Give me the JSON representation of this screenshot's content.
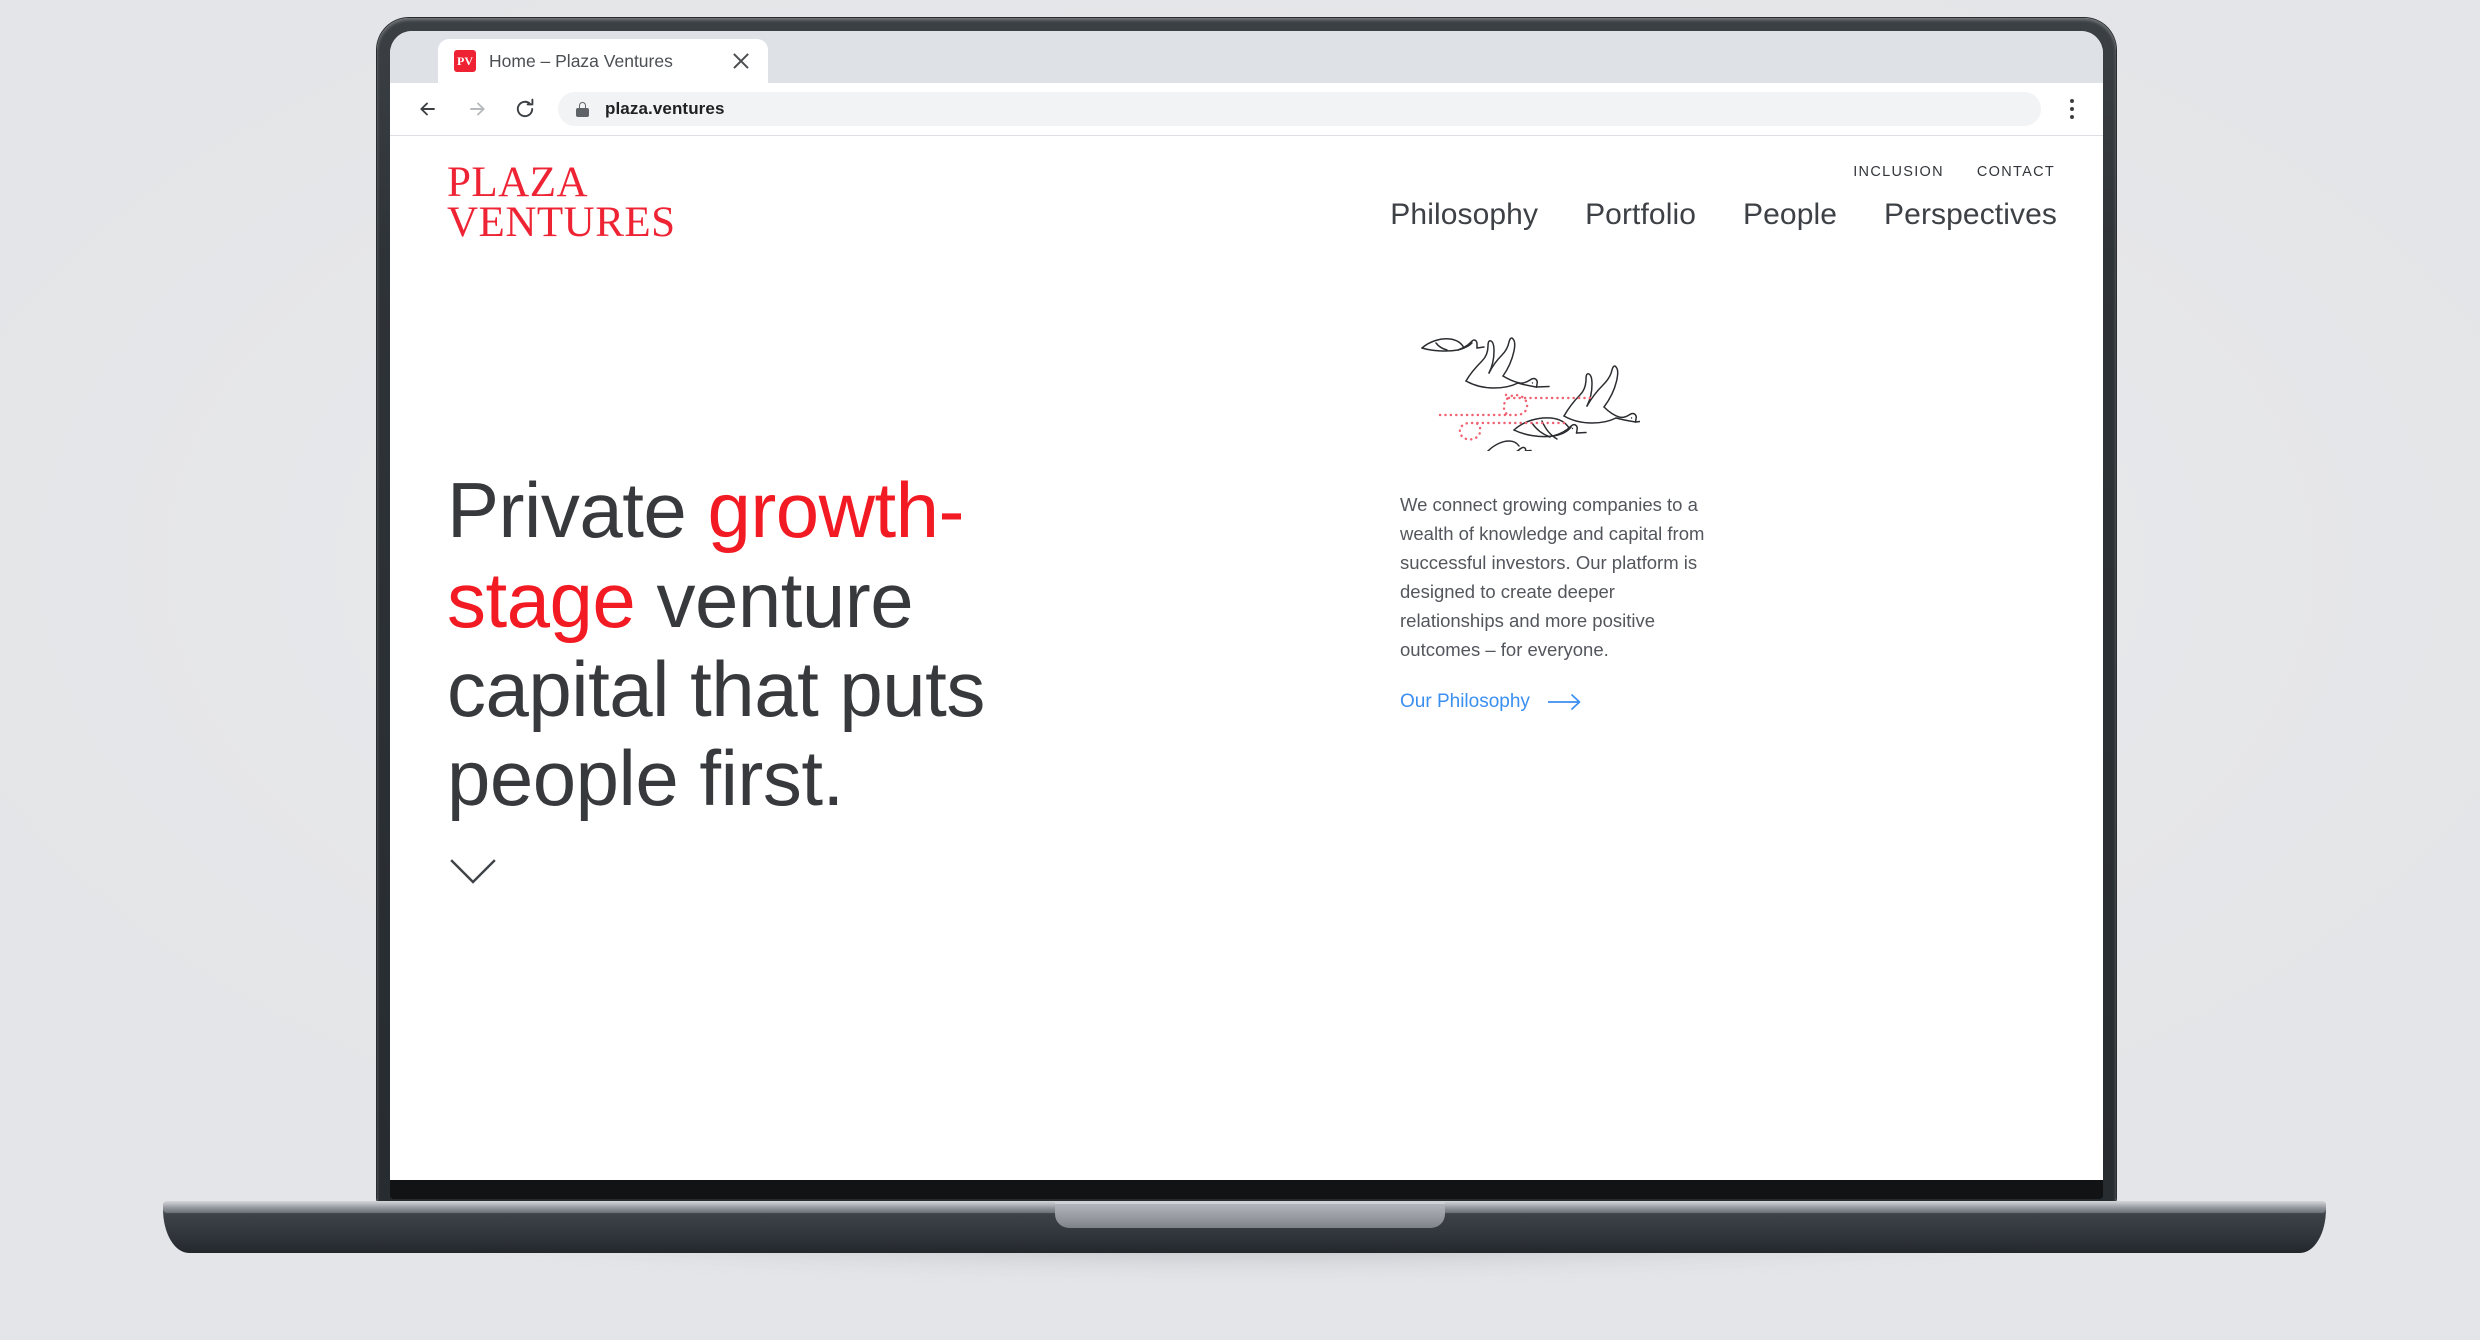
{
  "browser": {
    "tab": {
      "favicon_label": "PV",
      "title": "Home – Plaza Ventures"
    },
    "toolbar": {
      "back_icon": "arrow-left-icon",
      "forward_icon": "arrow-right-icon",
      "reload_icon": "reload-icon",
      "lock_icon": "lock-icon",
      "url": "plaza.ventures",
      "menu_icon": "kebab-menu-icon"
    }
  },
  "site": {
    "logo": {
      "line1": "PLAZA",
      "line2": "VENTURES",
      "color": "#ee2434"
    },
    "utility_nav": [
      {
        "label": "INCLUSION"
      },
      {
        "label": "CONTACT"
      }
    ],
    "main_nav": [
      {
        "label": "Philosophy"
      },
      {
        "label": "Portfolio"
      },
      {
        "label": "People"
      },
      {
        "label": "Perspectives"
      }
    ],
    "hero": {
      "headline_part1": "Private ",
      "headline_highlight": "growth-stage",
      "headline_part2": " venture capital that puts people first.",
      "highlight_color": "#f31b23",
      "body": "We connect growing companies to a wealth of knowledge and capital from successful investors. Our platform is designed to create deeper relationships and more positive outcomes – for everyone.",
      "cta_label": "Our Philosophy",
      "cta_color": "#3b8ff0",
      "cta_icon": "arrow-right-icon",
      "illustration_name": "flying-birds-illustration",
      "illustration_trail_color": "#f06272",
      "scroll_icon": "chevron-down-icon"
    }
  },
  "device": {
    "type": "laptop-mockup",
    "background_color": "#e9eaec"
  }
}
